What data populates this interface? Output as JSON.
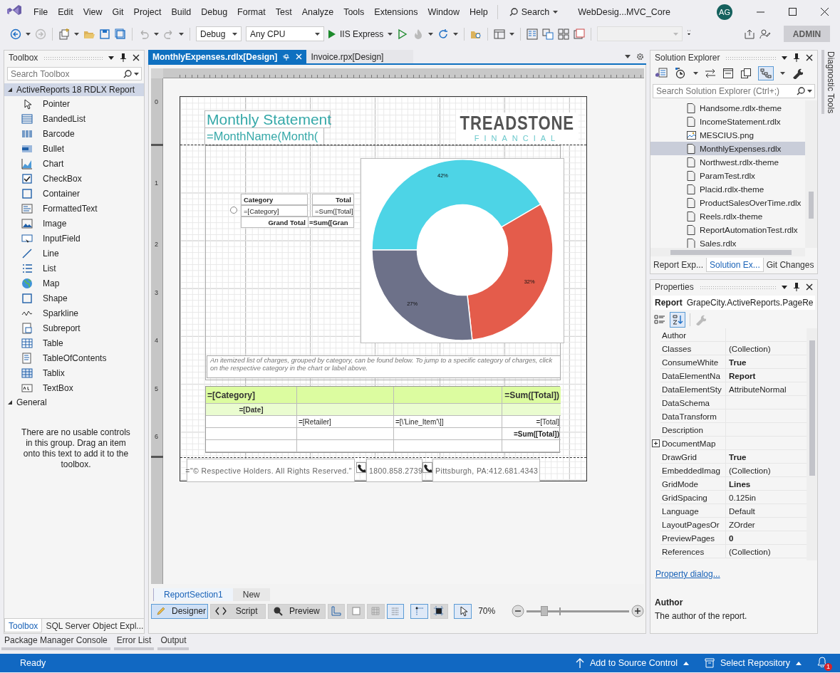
{
  "title_bar": {
    "menu": [
      "File",
      "Edit",
      "View",
      "Git",
      "Project",
      "Build",
      "Debug",
      "Format",
      "Test",
      "Analyze",
      "Tools",
      "Extensions",
      "Window",
      "Help"
    ],
    "search": "Search",
    "solution_name": "WebDesig...MVC_Core",
    "avatar_initials": "AG"
  },
  "toolbar": {
    "configuration": "Debug",
    "platform": "Any CPU",
    "run_target": "IIS Express",
    "admin_badge": "ADMIN"
  },
  "toolbox": {
    "title": "Toolbox",
    "search": {
      "placeholder": "Search Toolbox"
    },
    "groups": [
      {
        "label": "ActiveReports 18 RDLX Report",
        "expanded": true,
        "selected": true,
        "children": [
          {
            "label": "Pointer",
            "selected": false
          },
          {
            "label": "BandedList",
            "selected": false
          },
          {
            "label": "Barcode",
            "selected": false
          },
          {
            "label": "Bullet",
            "selected": false
          },
          {
            "label": "Chart",
            "selected": false
          },
          {
            "label": "CheckBox",
            "selected": false
          },
          {
            "label": "Container",
            "selected": false
          },
          {
            "label": "FormattedText",
            "selected": false
          },
          {
            "label": "Image",
            "selected": false
          },
          {
            "label": "InputField",
            "selected": false
          },
          {
            "label": "Line",
            "selected": false
          },
          {
            "label": "List",
            "selected": false
          },
          {
            "label": "Map",
            "selected": false
          },
          {
            "label": "Shape",
            "selected": false
          },
          {
            "label": "Sparkline",
            "selected": false
          },
          {
            "label": "Subreport",
            "selected": false
          },
          {
            "label": "Table",
            "selected": false
          },
          {
            "label": "TableOfContents",
            "selected": false
          },
          {
            "label": "Tablix",
            "selected": false
          },
          {
            "label": "TextBox",
            "selected": false
          }
        ]
      },
      {
        "label": "General",
        "expanded": true,
        "selected": false,
        "message": "There are no usable controls in this group. Drag an item onto this text to add it to the toolbox."
      }
    ],
    "tabs": [
      {
        "label": "Toolbox",
        "selected": true
      },
      {
        "label": "SQL Server Object Expl...",
        "selected": false
      }
    ]
  },
  "document_tabs": [
    {
      "label": "MonthlyExpenses.rdlx[Design]",
      "selected": true
    },
    {
      "label": "Invoice.rpx[Design]",
      "selected": false
    }
  ],
  "designer": {
    "vertical_ruler": [
      "0",
      "1",
      "2",
      "3",
      "4",
      "5",
      "6"
    ],
    "report": {
      "title": "Monthly Statement",
      "month_expression": "=MonthName(Month(",
      "logo": {
        "name": "TREADSTONE",
        "tagline": "FINANCIAL"
      },
      "summary_table": {
        "header": [
          "Category",
          "Total"
        ],
        "row": [
          "=[Category]",
          "=Sum([Total]"
        ],
        "total": [
          "Grand Total",
          "=Sum([Gran"
        ]
      },
      "chart": {
        "chart_data": {
          "type": "donut",
          "values": [
            42,
            32,
            27
          ],
          "value_labels": [
            "42%",
            "32%",
            "27%"
          ],
          "colors": [
            "#4dd4e6",
            "#e45c4b",
            "#6d7189"
          ]
        }
      },
      "description": "An itemized list of charges, grouped by category, can be found below. To jump to a specific category of charges, click on the respective category in the chart or label above.",
      "detail_table": [
        {
          "kind": "group",
          "column_1": "=[Category]",
          "column_4": "=Sum([Total])"
        },
        {
          "kind": "subgroup",
          "column_1": "=[Date]"
        },
        {
          "kind": "detail",
          "column_2": "=[Retailer]",
          "column_3": "=[\\'Line_Item'\\]]",
          "column_4": "=[Total]"
        },
        {
          "kind": "footer",
          "column_4": "=Sum([Total])"
        },
        {
          "kind": "blank"
        }
      ],
      "footer": {
        "copyright": "=\"© Respective Holders. All Rights Reserved.\"",
        "phone": "1800.858.2739",
        "address": "Pittsburgh, PA:412.681.4343"
      }
    },
    "section_tabs": [
      {
        "label": "ReportSection1",
        "selected": true
      },
      {
        "label": "New",
        "selected": false
      }
    ],
    "view_buttons": [
      {
        "label": "Designer",
        "selected": true
      },
      {
        "label": "Script",
        "selected": false
      },
      {
        "label": "Preview",
        "selected": false
      }
    ],
    "zoom": {
      "reading": "70%",
      "level": 0.17
    }
  },
  "solution_explorer": {
    "title": "Solution Explorer",
    "search": {
      "placeholder": "Search Solution Explorer (Ctrl+;)"
    },
    "files": [
      {
        "label": "Handsome.rdlx-theme",
        "kind": "file",
        "selected": false
      },
      {
        "label": "IncomeStatement.rdlx",
        "kind": "file",
        "selected": false
      },
      {
        "label": "MESCIUS.png",
        "kind": "image",
        "selected": false
      },
      {
        "label": "MonthlyExpenses.rdlx",
        "kind": "file",
        "selected": true
      },
      {
        "label": "Northwest.rdlx-theme",
        "kind": "file",
        "selected": false
      },
      {
        "label": "ParamTest.rdlx",
        "kind": "file",
        "selected": false
      },
      {
        "label": "Placid.rdlx-theme",
        "kind": "file",
        "selected": false
      },
      {
        "label": "ProductSalesOverTime.rdlx",
        "kind": "file",
        "selected": false
      },
      {
        "label": "Reels.rdlx-theme",
        "kind": "file",
        "selected": false
      },
      {
        "label": "ReportAutomationTest.rdlx",
        "kind": "file",
        "selected": false
      },
      {
        "label": "Sales.rdlx",
        "kind": "file",
        "selected": false
      }
    ],
    "tabs": [
      {
        "label": "Report Exp...",
        "selected": false
      },
      {
        "label": "Solution Ex...",
        "selected": true
      },
      {
        "label": "Git Changes",
        "selected": false
      }
    ]
  },
  "properties": {
    "title": "Properties",
    "object": "Report",
    "object_type": "GrapeCity.ActiveReports.PageRe",
    "rows": [
      {
        "name": "Author",
        "expandable": false
      },
      {
        "name": "Classes",
        "value": "(Collection)",
        "modified": false,
        "expandable": false
      },
      {
        "name": "ConsumeWhite",
        "value": "True",
        "modified": true,
        "expandable": false
      },
      {
        "name": "DataElementNa",
        "value": "Report",
        "modified": true,
        "expandable": false
      },
      {
        "name": "DataElementSty",
        "value": "AttributeNormal",
        "modified": false,
        "expandable": false
      },
      {
        "name": "DataSchema",
        "expandable": false
      },
      {
        "name": "DataTransform",
        "expandable": false
      },
      {
        "name": "Description",
        "expandable": false
      },
      {
        "name": "DocumentMap",
        "expandable": true
      },
      {
        "name": "DrawGrid",
        "value": "True",
        "modified": true,
        "expandable": false
      },
      {
        "name": "EmbeddedImag",
        "value": "(Collection)",
        "modified": false,
        "expandable": false
      },
      {
        "name": "GridMode",
        "value": "Lines",
        "modified": true,
        "expandable": false
      },
      {
        "name": "GridSpacing",
        "value": "0.125in",
        "modified": false,
        "expandable": false
      },
      {
        "name": "Language",
        "value": "Default",
        "modified": false,
        "expandable": false
      },
      {
        "name": "LayoutPagesOr",
        "value": "ZOrder",
        "modified": false,
        "expandable": false
      },
      {
        "name": "PreviewPages",
        "value": "0",
        "modified": true,
        "expandable": false
      },
      {
        "name": "References",
        "value": "(Collection)",
        "modified": false,
        "expandable": false
      }
    ],
    "link": "Property dialog...",
    "description_title": "Author",
    "description": "The author of the report."
  },
  "side_tab": "Diagnostic Tools",
  "tool_windows": [
    "Package Manager Console",
    "Error List",
    "Output"
  ],
  "status_bar": {
    "state": "Ready",
    "source_control": "Add to Source Control",
    "repository": "Select Repository",
    "notifications": "1"
  }
}
